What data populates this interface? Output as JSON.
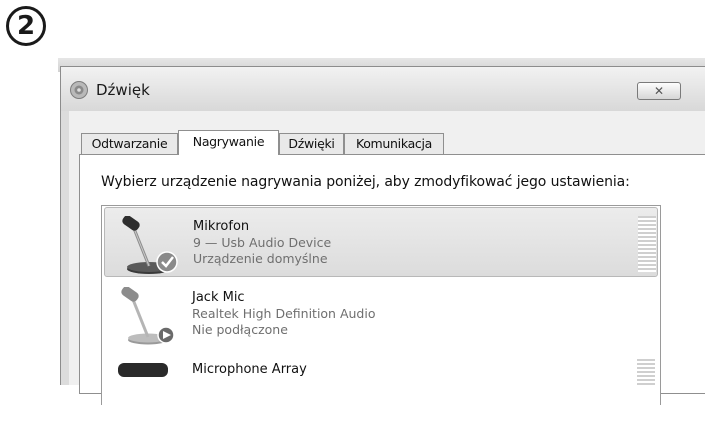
{
  "step_number": "2",
  "window": {
    "title": "Dźwięk",
    "close_glyph": "✕"
  },
  "tabs": [
    {
      "label": "Odtwarzanie",
      "active": false
    },
    {
      "label": "Nagrywanie",
      "active": true
    },
    {
      "label": "Dźwięki",
      "active": false
    },
    {
      "label": "Komunikacja",
      "active": false
    }
  ],
  "instructions": "Wybierz urządzenie nagrywania poniżej, aby zmodyfikować jego ustawienia:",
  "devices": [
    {
      "name": "Mikrofon",
      "detail": "9 — Usb Audio Device",
      "status": "Urządzenie domyślne",
      "selected": true,
      "icon": "microphone-default-check-icon"
    },
    {
      "name": "Jack Mic",
      "detail": "Realtek High Definition Audio",
      "status": "Nie podłączone",
      "selected": false,
      "icon": "microphone-unplugged-icon"
    },
    {
      "name": "Microphone Array",
      "detail": "",
      "status": "",
      "selected": false,
      "icon": "microphone-array-icon"
    }
  ],
  "colors": {
    "check_badge": "#8a8a8a",
    "unplugged_badge": "#6a6a6a"
  }
}
